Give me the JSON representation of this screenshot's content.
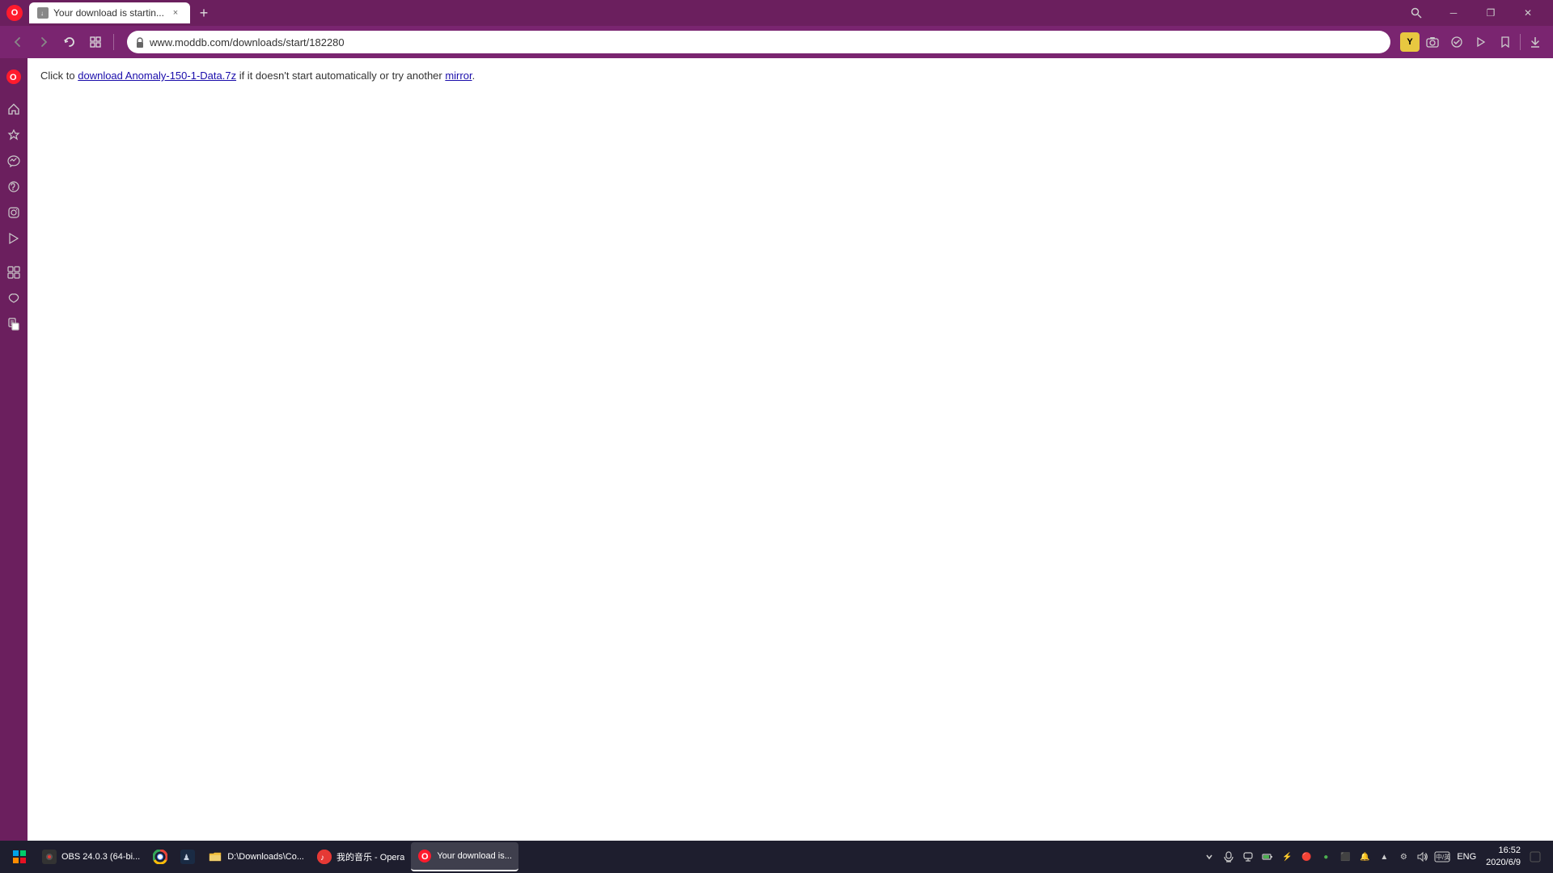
{
  "browser": {
    "title_bar": {
      "tab_title": "Your download is startin...",
      "tab_close_label": "×",
      "new_tab_label": "+",
      "window_minimize": "─",
      "window_restore": "❐",
      "window_close": "✕"
    },
    "nav_bar": {
      "back_btn": "‹",
      "forward_btn": "›",
      "reload_btn": "↻",
      "tabs_btn": "⧉",
      "address": "www.moddb.com/downloads/start/182280",
      "search_icon": "🔍"
    },
    "toolbar": {
      "yellow_label": "Y",
      "cam_icon": "📷",
      "check_icon": "✓",
      "play_icon": "▶",
      "heart_icon": "♥",
      "download_icon": "⬇"
    },
    "sidebar": {
      "opera_logo": "O",
      "home_icon": "⌂",
      "star_icon": "☆",
      "messenger_icon": "💬",
      "whatsapp_icon": "📱",
      "instagram_icon": "📸",
      "player_icon": "▷",
      "apps_icon": "⊞",
      "favorites_icon": "♡",
      "history_icon": "🕒",
      "more_icon": "···"
    }
  },
  "page": {
    "instruction_text_before_link": "Click to ",
    "file_link_text": "download Anomaly-150-1-Data.7z",
    "instruction_text_after_link": " if it doesn't start automatically or try another ",
    "mirror_link_text": "mirror",
    "instruction_end": "."
  },
  "taskbar": {
    "start_icon": "⊞",
    "items": [
      {
        "id": "obs",
        "label": "OBS 24.0.3 (64-bi...",
        "icon_text": "●",
        "icon_color": "#333",
        "active": false
      },
      {
        "id": "chrome",
        "label": "",
        "icon_text": "🌐",
        "icon_color": "#fff",
        "active": false
      },
      {
        "id": "steam",
        "label": "",
        "icon_text": "♟",
        "icon_color": "#fff",
        "active": false
      },
      {
        "id": "explorer",
        "label": "D:\\Downloads\\Co...",
        "icon_text": "📁",
        "icon_color": "#fff",
        "active": false
      },
      {
        "id": "qqmusic",
        "label": "我的音乐 - Opera",
        "icon_text": "♪",
        "icon_color": "#e53935",
        "active": false
      },
      {
        "id": "opera",
        "label": "Your download is...",
        "icon_text": "O",
        "icon_color": "#ff1b2d",
        "active": true
      }
    ],
    "tray_icons": [
      "🔊",
      "🌐",
      "🔋"
    ],
    "clock_time": "16:52",
    "clock_date": "2020/6/9",
    "language": "ENG",
    "notification_count": ""
  },
  "colors": {
    "browser_chrome": "#6b1f5e",
    "nav_bar": "#7a2570",
    "tab_active_bg": "#ffffff",
    "taskbar_bg": "#1e1e2e",
    "opera_red": "#ff1b2d",
    "link_color": "#1a0dab"
  }
}
